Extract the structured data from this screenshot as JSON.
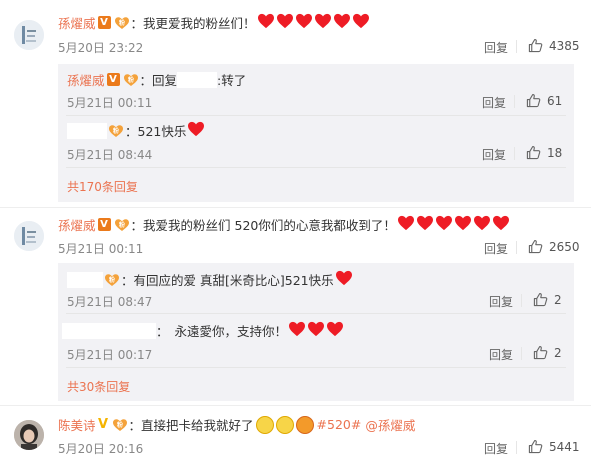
{
  "comments": [
    {
      "name": "孫燿威",
      "text": "我更爱我的粉丝们！",
      "time": "5月20日 23:22",
      "reply_label": "回复",
      "likes": "4385",
      "hearts": 6,
      "replies": [
        {
          "name": "孫燿威",
          "prefix": "回复",
          "text": ":转了",
          "time": "5月21日 00:11",
          "reply_label": "回复",
          "likes": "61"
        },
        {
          "text": "521快乐",
          "time": "5月21日 08:44",
          "reply_label": "回复",
          "likes": "18"
        }
      ],
      "more_label": "共170条回复"
    },
    {
      "name": "孫燿威",
      "text": "我爱我的粉丝们 520你们的心意我都收到了！",
      "time": "5月21日 00:11",
      "reply_label": "回复",
      "likes": "2650",
      "hearts": 6,
      "replies": [
        {
          "text": "有回应的爱 真甜[米奇比心]521快乐",
          "time": "5月21日 08:47",
          "reply_label": "回复",
          "likes": "2"
        },
        {
          "text": "永遠愛你，支持你！",
          "time": "5月21日 00:17",
          "reply_label": "回复",
          "likes": "2"
        }
      ],
      "more_label": "共30条回复"
    },
    {
      "name": "陈美诗",
      "text": "直接把卡给我就好了",
      "topic": "#520#",
      "mention": "@孫燿威",
      "time": "5月20日 20:16",
      "reply_label": "回复",
      "likes": "5441"
    }
  ],
  "colors": {
    "accent": "#eb7350",
    "heart": "#ee1c25",
    "sub_bg": "#f2f2f5",
    "badge": "#eb7a1b"
  },
  "icons": {
    "like": "thumbs-up-icon",
    "verified": "verified-v-icon",
    "fan": "fan-badge-icon",
    "heart": "red-heart-icon"
  }
}
